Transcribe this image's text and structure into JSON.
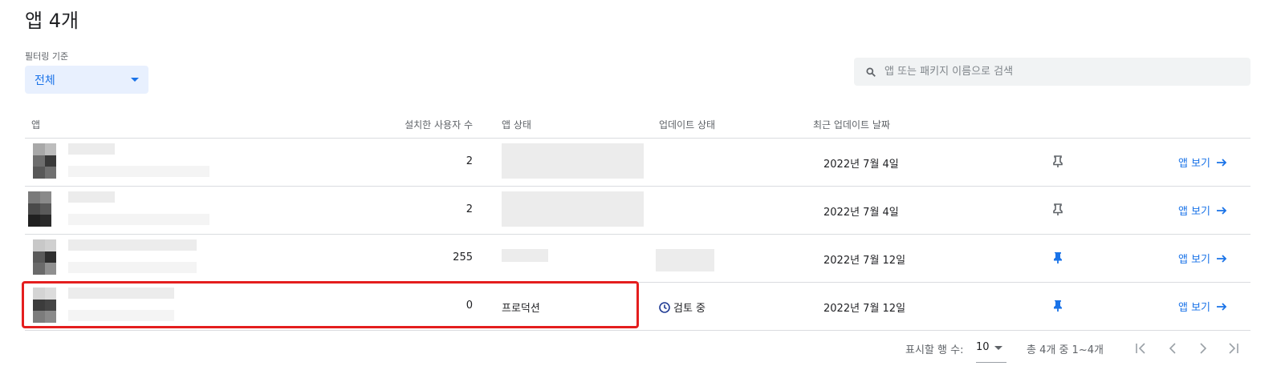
{
  "page": {
    "title": "앱 4개"
  },
  "filter": {
    "label": "필터링 기준",
    "value": "전체"
  },
  "search": {
    "placeholder": "앱 또는 패키지 이름으로 검색"
  },
  "table": {
    "headers": {
      "app": "앱",
      "users": "설치한 사용자 수",
      "status": "앱 상태",
      "update": "업데이트 상태",
      "date": "최근 업데이트 날짜"
    },
    "rows": [
      {
        "users": "2",
        "status": "",
        "update": "",
        "date": "2022년 7월 4일",
        "pinned": false,
        "view": "앱 보기"
      },
      {
        "users": "2",
        "status": "",
        "update": "",
        "date": "2022년 7월 4일",
        "pinned": false,
        "view": "앱 보기"
      },
      {
        "users": "255",
        "status": "",
        "update": "",
        "date": "2022년 7월 12일",
        "pinned": true,
        "view": "앱 보기"
      },
      {
        "users": "0",
        "status": "프로덕션",
        "update": "검토 중",
        "date": "2022년 7월 12일",
        "pinned": true,
        "view": "앱 보기"
      }
    ]
  },
  "pagination": {
    "rows_label": "표시할 행 수:",
    "rows_value": "10",
    "range": "총 4개 중 1~4개"
  },
  "colors": {
    "accent": "#1a73e8",
    "highlight": "#e41e1e"
  }
}
